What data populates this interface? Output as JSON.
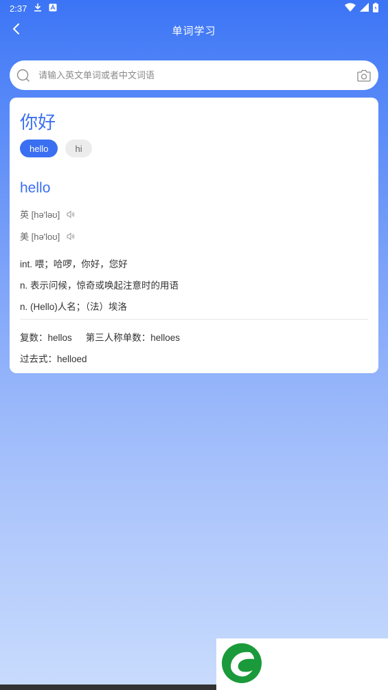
{
  "status_bar": {
    "time": "2:37",
    "icons": [
      "download-icon",
      "notification-a-icon",
      "wifi-icon",
      "signal-icon",
      "battery-icon"
    ]
  },
  "header": {
    "title": "单词学习",
    "back_icon": "chevron-left-icon"
  },
  "search": {
    "placeholder": "请输入英文单词或者中文词语",
    "value": "",
    "search_icon": "search-icon",
    "camera_icon": "camera-icon"
  },
  "result": {
    "query": "你好",
    "chips": [
      {
        "label": "hello",
        "active": true
      },
      {
        "label": "hi",
        "active": false
      }
    ],
    "word": "hello",
    "phonetics": {
      "uk": "英 [hə'ləʊ]",
      "us": "美 [hə'loʊ]"
    },
    "definitions": [
      "int. 喂；哈啰，你好，您好",
      "n. 表示问候，惊奇或唤起注意时的用语",
      "n. (Hello)人名；（法）埃洛"
    ],
    "forms": {
      "plural": "复数：hellos",
      "third_person": "第三人称单数：helloes",
      "past": "过去式：helloed"
    }
  },
  "colors": {
    "accent": "#3a6ff2",
    "gradient_top": "#3b74f5",
    "gradient_bottom": "#c9dcfd",
    "logo_green": "#1a9a3a"
  }
}
